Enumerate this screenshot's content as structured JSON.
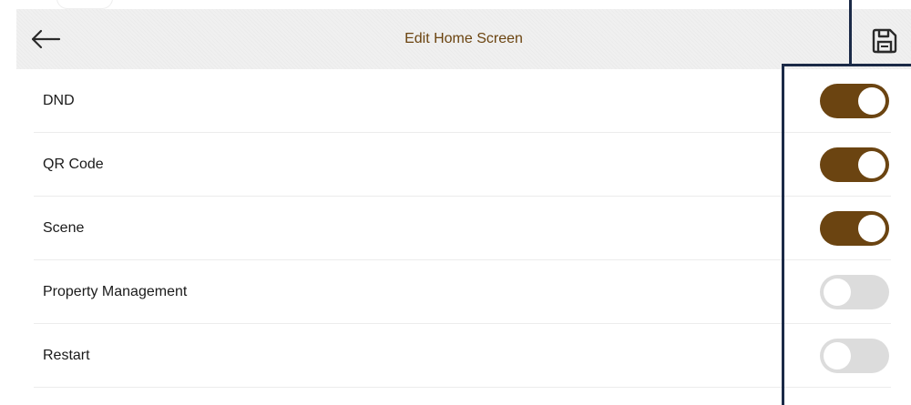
{
  "header": {
    "title": "Edit Home Screen",
    "back_icon": "arrow-left-icon",
    "save_icon": "floppy-disk-icon"
  },
  "settings": [
    {
      "label": "DND",
      "enabled": true
    },
    {
      "label": "QR Code",
      "enabled": true
    },
    {
      "label": "Scene",
      "enabled": true
    },
    {
      "label": "Property Management",
      "enabled": false
    },
    {
      "label": "Restart",
      "enabled": false
    }
  ],
  "colors": {
    "accent": "#6b4411",
    "title_text": "#6b4410",
    "toggle_off": "#dcdcdc",
    "callout": "#1b2a47",
    "header_bg": "#f0f0f0"
  }
}
